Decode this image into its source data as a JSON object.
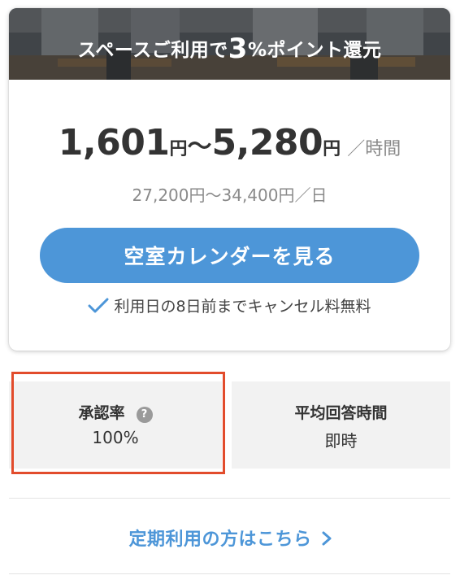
{
  "banner": {
    "text_before": "スペースご利用で",
    "rate_number": "3",
    "rate_symbol": "%",
    "text_after": "ポイント還元"
  },
  "price": {
    "min": "1,601",
    "max": "5,280",
    "currency": "円",
    "separator": "〜",
    "unit": "／時間",
    "daily": "27,200円〜34,400円／日"
  },
  "cta": {
    "label": "空室カレンダーを見る"
  },
  "cancellation": {
    "note": "利用日の8日前までキャンセル料無料",
    "icon": "check-icon"
  },
  "stats": {
    "approval": {
      "title": "承認率",
      "value": "100%",
      "help_icon": "question-icon",
      "help_glyph": "?"
    },
    "response": {
      "title": "平均回答時間",
      "value": "即時"
    }
  },
  "regular_link": {
    "label": "定期利用の方はこちら",
    "icon": "chevron-right-icon"
  },
  "colors": {
    "accent": "#4d96d8",
    "highlight": "#e24c2c",
    "stat_background": "#f2f2f2",
    "text": "#333333",
    "muted": "#8a8a8a"
  }
}
